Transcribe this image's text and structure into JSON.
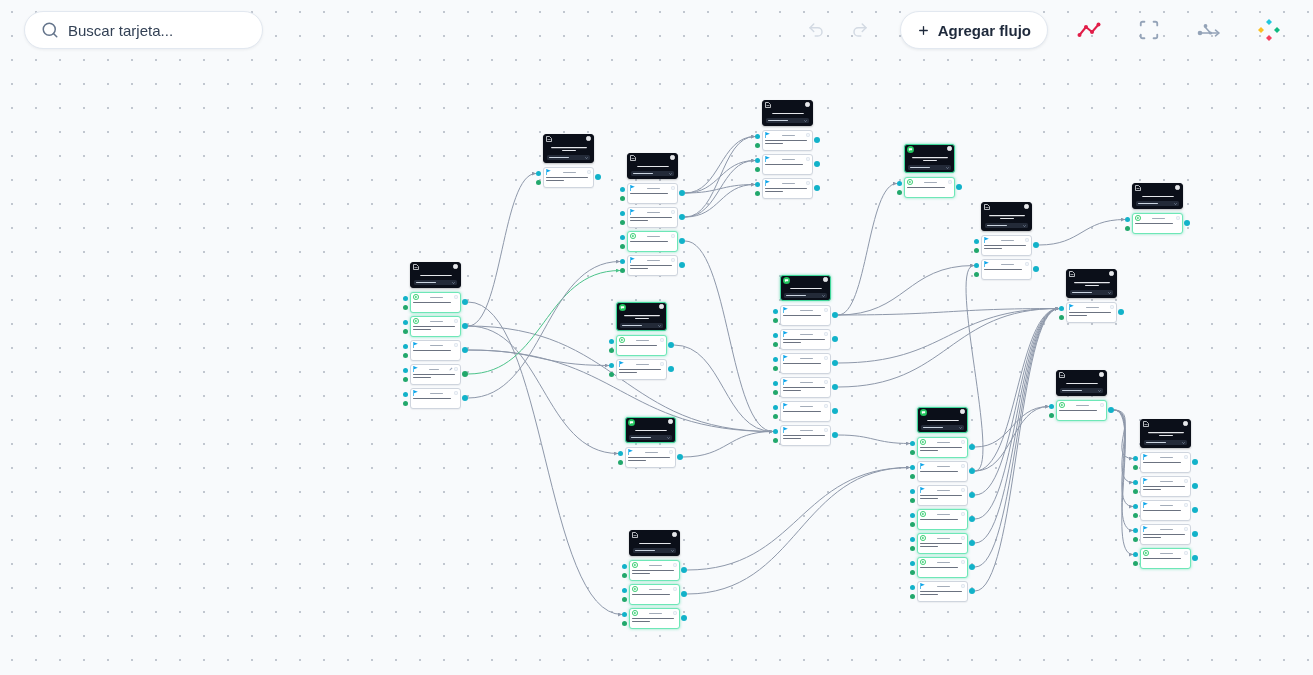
{
  "toolbar": {
    "search": {
      "placeholder": "Buscar tarjeta..."
    },
    "undo": {
      "disabled": true
    },
    "redo": {
      "disabled": true
    },
    "add_button": {
      "label": "Agregar flujo"
    }
  },
  "flow": {
    "nodes": [
      {
        "kind": "document",
        "cards": [
          {
            "kind": "action",
            "active": true
          },
          {
            "kind": "action",
            "active": true
          },
          {
            "kind": "action",
            "active": false
          },
          {
            "kind": "branch",
            "active": false
          },
          {
            "kind": "action",
            "active": false
          }
        ]
      },
      {
        "kind": "document",
        "cards": [
          {
            "kind": "action",
            "active": false
          }
        ]
      },
      {
        "kind": "document",
        "cards": [
          {
            "kind": "action",
            "active": false
          },
          {
            "kind": "action",
            "active": false
          },
          {
            "kind": "action",
            "active": true
          },
          {
            "kind": "action",
            "active": false
          }
        ]
      },
      {
        "kind": "document",
        "cards": [
          {
            "kind": "action",
            "active": false
          },
          {
            "kind": "action",
            "active": false
          },
          {
            "kind": "action",
            "active": false
          }
        ]
      },
      {
        "kind": "chat",
        "cards": [
          {
            "kind": "action",
            "active": true
          },
          {
            "kind": "action",
            "active": false
          }
        ]
      },
      {
        "kind": "chat",
        "cards": [
          {
            "kind": "action",
            "active": false
          }
        ]
      },
      {
        "kind": "chat",
        "cards": [
          {
            "kind": "action",
            "active": false
          },
          {
            "kind": "action",
            "active": false
          },
          {
            "kind": "action",
            "active": false
          },
          {
            "kind": "action",
            "active": false
          },
          {
            "kind": "action",
            "active": false
          },
          {
            "kind": "action",
            "active": false
          }
        ]
      },
      {
        "kind": "document",
        "cards": [
          {
            "kind": "action",
            "active": true
          },
          {
            "kind": "action",
            "active": true
          },
          {
            "kind": "action",
            "active": true
          }
        ]
      },
      {
        "kind": "chat",
        "cards": [
          {
            "kind": "action",
            "active": true
          }
        ]
      },
      {
        "kind": "document",
        "cards": [
          {
            "kind": "action",
            "active": false
          },
          {
            "kind": "action",
            "active": false
          }
        ]
      },
      {
        "kind": "document",
        "cards": [
          {
            "kind": "action",
            "active": true
          }
        ]
      },
      {
        "kind": "document",
        "cards": [
          {
            "kind": "action",
            "active": false
          }
        ]
      },
      {
        "kind": "document",
        "cards": [
          {
            "kind": "action",
            "active": true
          }
        ]
      },
      {
        "kind": "chat",
        "cards": [
          {
            "kind": "action",
            "active": true
          },
          {
            "kind": "action",
            "active": false
          },
          {
            "kind": "action",
            "active": false
          },
          {
            "kind": "action",
            "active": true
          },
          {
            "kind": "action",
            "active": true
          },
          {
            "kind": "action",
            "active": true
          },
          {
            "kind": "action",
            "active": false
          }
        ]
      },
      {
        "kind": "document",
        "cards": [
          {
            "kind": "action",
            "active": false
          },
          {
            "kind": "action",
            "active": false
          },
          {
            "kind": "action",
            "active": false
          },
          {
            "kind": "action",
            "active": false
          },
          {
            "kind": "action",
            "active": true
          }
        ]
      }
    ]
  }
}
